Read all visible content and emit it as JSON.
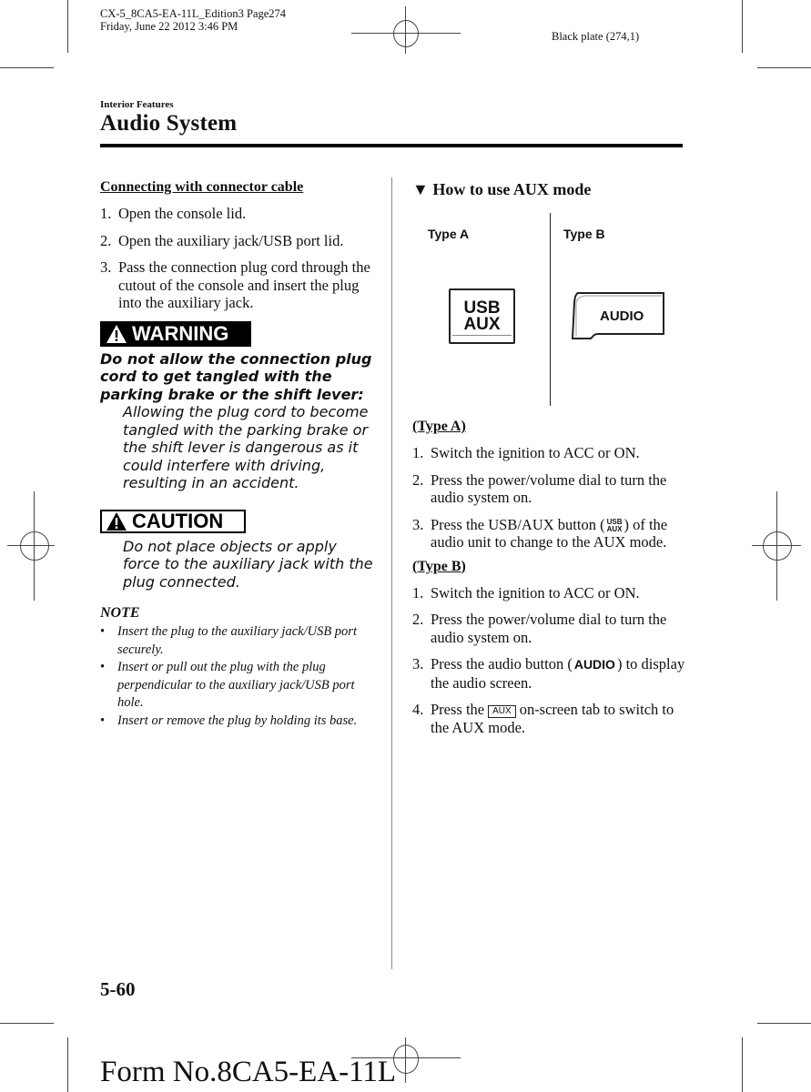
{
  "print_header": {
    "file_line": "CX-5_8CA5-EA-11L_Edition3 Page274",
    "date_line": "Friday, June 22 2012 3:46 PM",
    "plate": "Black plate (274,1)"
  },
  "page_header": {
    "section": "Interior Features",
    "title": "Audio System"
  },
  "left_column": {
    "subheading": "Connecting with connector cable",
    "steps": [
      {
        "num": "1.",
        "text": "Open the console lid."
      },
      {
        "num": "2.",
        "text": "Open the auxiliary jack/USB port lid."
      },
      {
        "num": "3.",
        "text": "Pass the connection plug cord through the cutout of the console and insert the plug into the auxiliary jack."
      }
    ],
    "warning": {
      "label": "WARNING",
      "icon": "warning-triangle-icon",
      "lead": "Do not allow the connection plug cord to get tangled with the parking brake or the shift lever:",
      "body": "Allowing the plug cord to become tangled with the parking brake or the shift lever is dangerous as it could interfere with driving, resulting in an accident."
    },
    "caution": {
      "label": "CAUTION",
      "icon": "caution-triangle-icon",
      "body": "Do not place objects or apply force to the auxiliary jack with the plug connected."
    },
    "note": {
      "title": "NOTE",
      "items": [
        "Insert the plug to the auxiliary jack/USB port securely.",
        "Insert or pull out the plug with the plug perpendicular to the auxiliary jack/USB port hole.",
        "Insert or remove the plug by holding its base."
      ]
    }
  },
  "right_column": {
    "heading_marker": "▼",
    "heading": "How to use AUX mode",
    "illustration": {
      "type_a_label": "Type A",
      "type_b_label": "Type B",
      "usb_line1": "USB",
      "usb_line2": "AUX",
      "audio_label": "AUDIO"
    },
    "type_a": {
      "heading": "(Type A)",
      "steps": [
        {
          "num": "1.",
          "text": "Switch the ignition to ACC or ON."
        },
        {
          "num": "2.",
          "text": "Press the power/volume dial to turn the audio system on."
        },
        {
          "num": "3.",
          "before": "Press the USB/AUX button (",
          "glyph_top": "USB",
          "glyph_bottom": "AUX",
          "after": ") of the audio unit to change to the AUX mode."
        }
      ]
    },
    "type_b": {
      "heading": "(Type B)",
      "steps": [
        {
          "num": "1.",
          "text": "Switch the ignition to ACC or ON."
        },
        {
          "num": "2.",
          "text": "Press the power/volume dial to turn the audio system on."
        },
        {
          "num": "3.",
          "before": "Press the audio button (",
          "glyph": "AUDIO",
          "after": ") to display the audio screen."
        },
        {
          "num": "4.",
          "before": "Press the",
          "glyph": "AUX",
          "after": "on-screen tab to switch to the AUX mode."
        }
      ]
    }
  },
  "footer": {
    "page_number": "5-60",
    "form_number": "Form No.8CA5-EA-11L"
  }
}
